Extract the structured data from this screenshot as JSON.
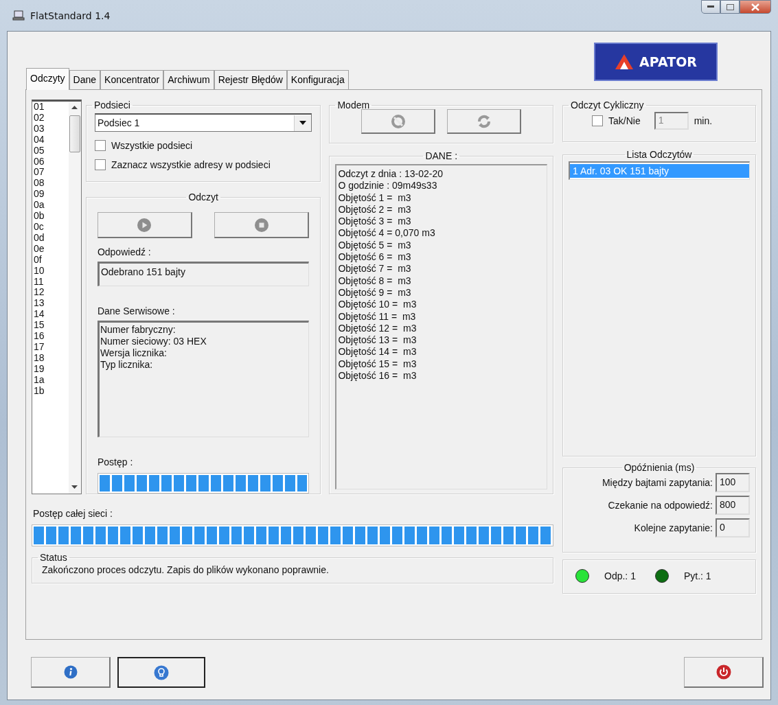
{
  "window": {
    "title": "FlatStandard 1.4"
  },
  "logo": {
    "text": "APATOR"
  },
  "tabs": [
    {
      "label": "Odczyty",
      "selected": true
    },
    {
      "label": "Dane",
      "selected": false
    },
    {
      "label": "Koncentrator",
      "selected": false
    },
    {
      "label": "Archiwum",
      "selected": false
    },
    {
      "label": "Rejestr Błędów",
      "selected": false
    },
    {
      "label": "Konfiguracja",
      "selected": false
    }
  ],
  "addresses": [
    {
      "label": "01",
      "selected": false
    },
    {
      "label": "02",
      "selected": false
    },
    {
      "label": "03",
      "selected": false
    },
    {
      "label": "04",
      "selected": false
    },
    {
      "label": "05",
      "selected": false
    },
    {
      "label": "06",
      "selected": false
    },
    {
      "label": "07",
      "selected": false
    },
    {
      "label": "08",
      "selected": false
    },
    {
      "label": "09",
      "selected": false
    },
    {
      "label": "0a",
      "selected": false
    },
    {
      "label": "0b",
      "selected": false
    },
    {
      "label": "0c",
      "selected": false
    },
    {
      "label": "0d",
      "selected": false
    },
    {
      "label": "0e",
      "selected": false
    },
    {
      "label": "0f",
      "selected": false
    },
    {
      "label": "10",
      "selected": false
    },
    {
      "label": "11",
      "selected": false
    },
    {
      "label": "12",
      "selected": false
    },
    {
      "label": "13",
      "selected": false
    },
    {
      "label": "14",
      "selected": false
    },
    {
      "label": "15",
      "selected": false
    },
    {
      "label": "16",
      "selected": false
    },
    {
      "label": "17",
      "selected": false
    },
    {
      "label": "18",
      "selected": false
    },
    {
      "label": "19",
      "selected": false
    },
    {
      "label": "1a",
      "selected": false
    },
    {
      "label": "1b",
      "selected": false
    }
  ],
  "subnets": {
    "title": "Podsieci",
    "dropdown_value": "Podsiec 1",
    "options": [
      {
        "label": "Wszystkie podsieci",
        "checked": false
      },
      {
        "label": "Zaznacz wszystkie adresy w podsieci",
        "checked": false
      }
    ]
  },
  "reading": {
    "title": "Odczyt",
    "response_label": "Odpowiedź :",
    "response_value": "Odebrano 151 bajty",
    "service_label": "Dane Serwisowe :",
    "service_lines": [
      "Numer fabryczny:",
      "Numer sieciowy: 03 HEX",
      "Wersja licznika:",
      "Typ licznika:"
    ],
    "progress_label": "Postęp :",
    "progress": {
      "level": 1
    }
  },
  "modem": {
    "title": "Modem"
  },
  "data": {
    "title": "DANE :",
    "lines": [
      "Odczyt z dnia : 13-02-20",
      "O godzinie : 09m49s33",
      "Objętość 1 =  m3",
      "Objętość 2 =  m3",
      "Objętość 3 =  m3",
      "Objętość 4 = 0,070 m3",
      "Objętość 5 =  m3",
      "Objętość 6 =  m3",
      "Objętość 7 =  m3",
      "Objętość 8 =  m3",
      "Objętość 9 =  m3",
      "Objętość 10 =  m3",
      "Objętość 11 =  m3",
      "Objętość 12 =  m3",
      "Objętość 13 =  m3",
      "Objętość 14 =  m3",
      "Objętość 15 =  m3",
      "Objętość 16 =  m3"
    ]
  },
  "cyclic": {
    "title": "Odczyt Cykliczny",
    "checkbox": {
      "label": "Tak/Nie",
      "checked": false
    },
    "interval": {
      "value": "1",
      "disabled": true
    },
    "unit": "min."
  },
  "readings_list": {
    "title": "Lista Odczytów",
    "items": [
      {
        "label": "1 Adr. 03 OK 151 bajty",
        "selected": true
      }
    ]
  },
  "delays": {
    "title": "Opóźnienia (ms)",
    "fields": [
      {
        "label": "Między bajtami zapytania:",
        "value": "100"
      },
      {
        "label": "Czekanie na odpowiedź:",
        "value": "800"
      },
      {
        "label": "Kolejne zapytanie:",
        "value": "0"
      }
    ]
  },
  "indicators": [
    {
      "label": "Odp.: 1",
      "on": true
    },
    {
      "label": "Pyt.: 1",
      "on": false
    }
  ],
  "network_progress": {
    "label": "Postęp całej sieci :",
    "level": 1
  },
  "status": {
    "title": "Status",
    "message": "Zakończono proces odczytu. Zapis do plików wykonano poprawnie."
  }
}
